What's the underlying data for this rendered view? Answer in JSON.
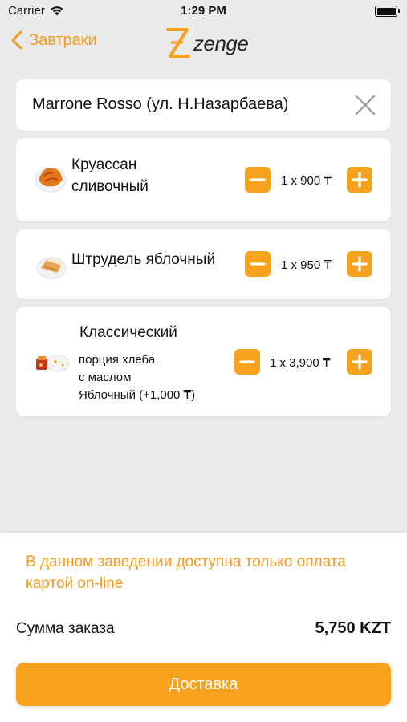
{
  "status_bar": {
    "carrier": "Carrier",
    "time": "1:29 PM"
  },
  "nav": {
    "back_label": "Завтраки",
    "logo_text": "zenge"
  },
  "restaurant": {
    "name": "Marrone Rosso (ул. Н.Назарбаева)"
  },
  "cart_items": [
    {
      "name_line1": "Круассан",
      "name_line2": "сливочный",
      "quantity_price": "1 x 900 ₸"
    },
    {
      "name_line1": "Штрудель яблочный",
      "quantity_price": "1 x 950 ₸"
    },
    {
      "name_line1": "Классический",
      "mod_line1": "порция хлеба",
      "mod_line2": "с маслом",
      "mod_line3": "Яблочный (+1,000 ₸)",
      "quantity_price": "1 x 3,900 ₸"
    }
  ],
  "footer": {
    "payment_note": "В данном заведении доступна только оплата картой on-line",
    "sum_label": "Сумма заказа",
    "sum_value": "5,750 KZT",
    "delivery_button": "Доставка"
  },
  "colors": {
    "accent": "#f7a21f",
    "accent_text": "#f39a1e",
    "background": "#ebebeb"
  }
}
